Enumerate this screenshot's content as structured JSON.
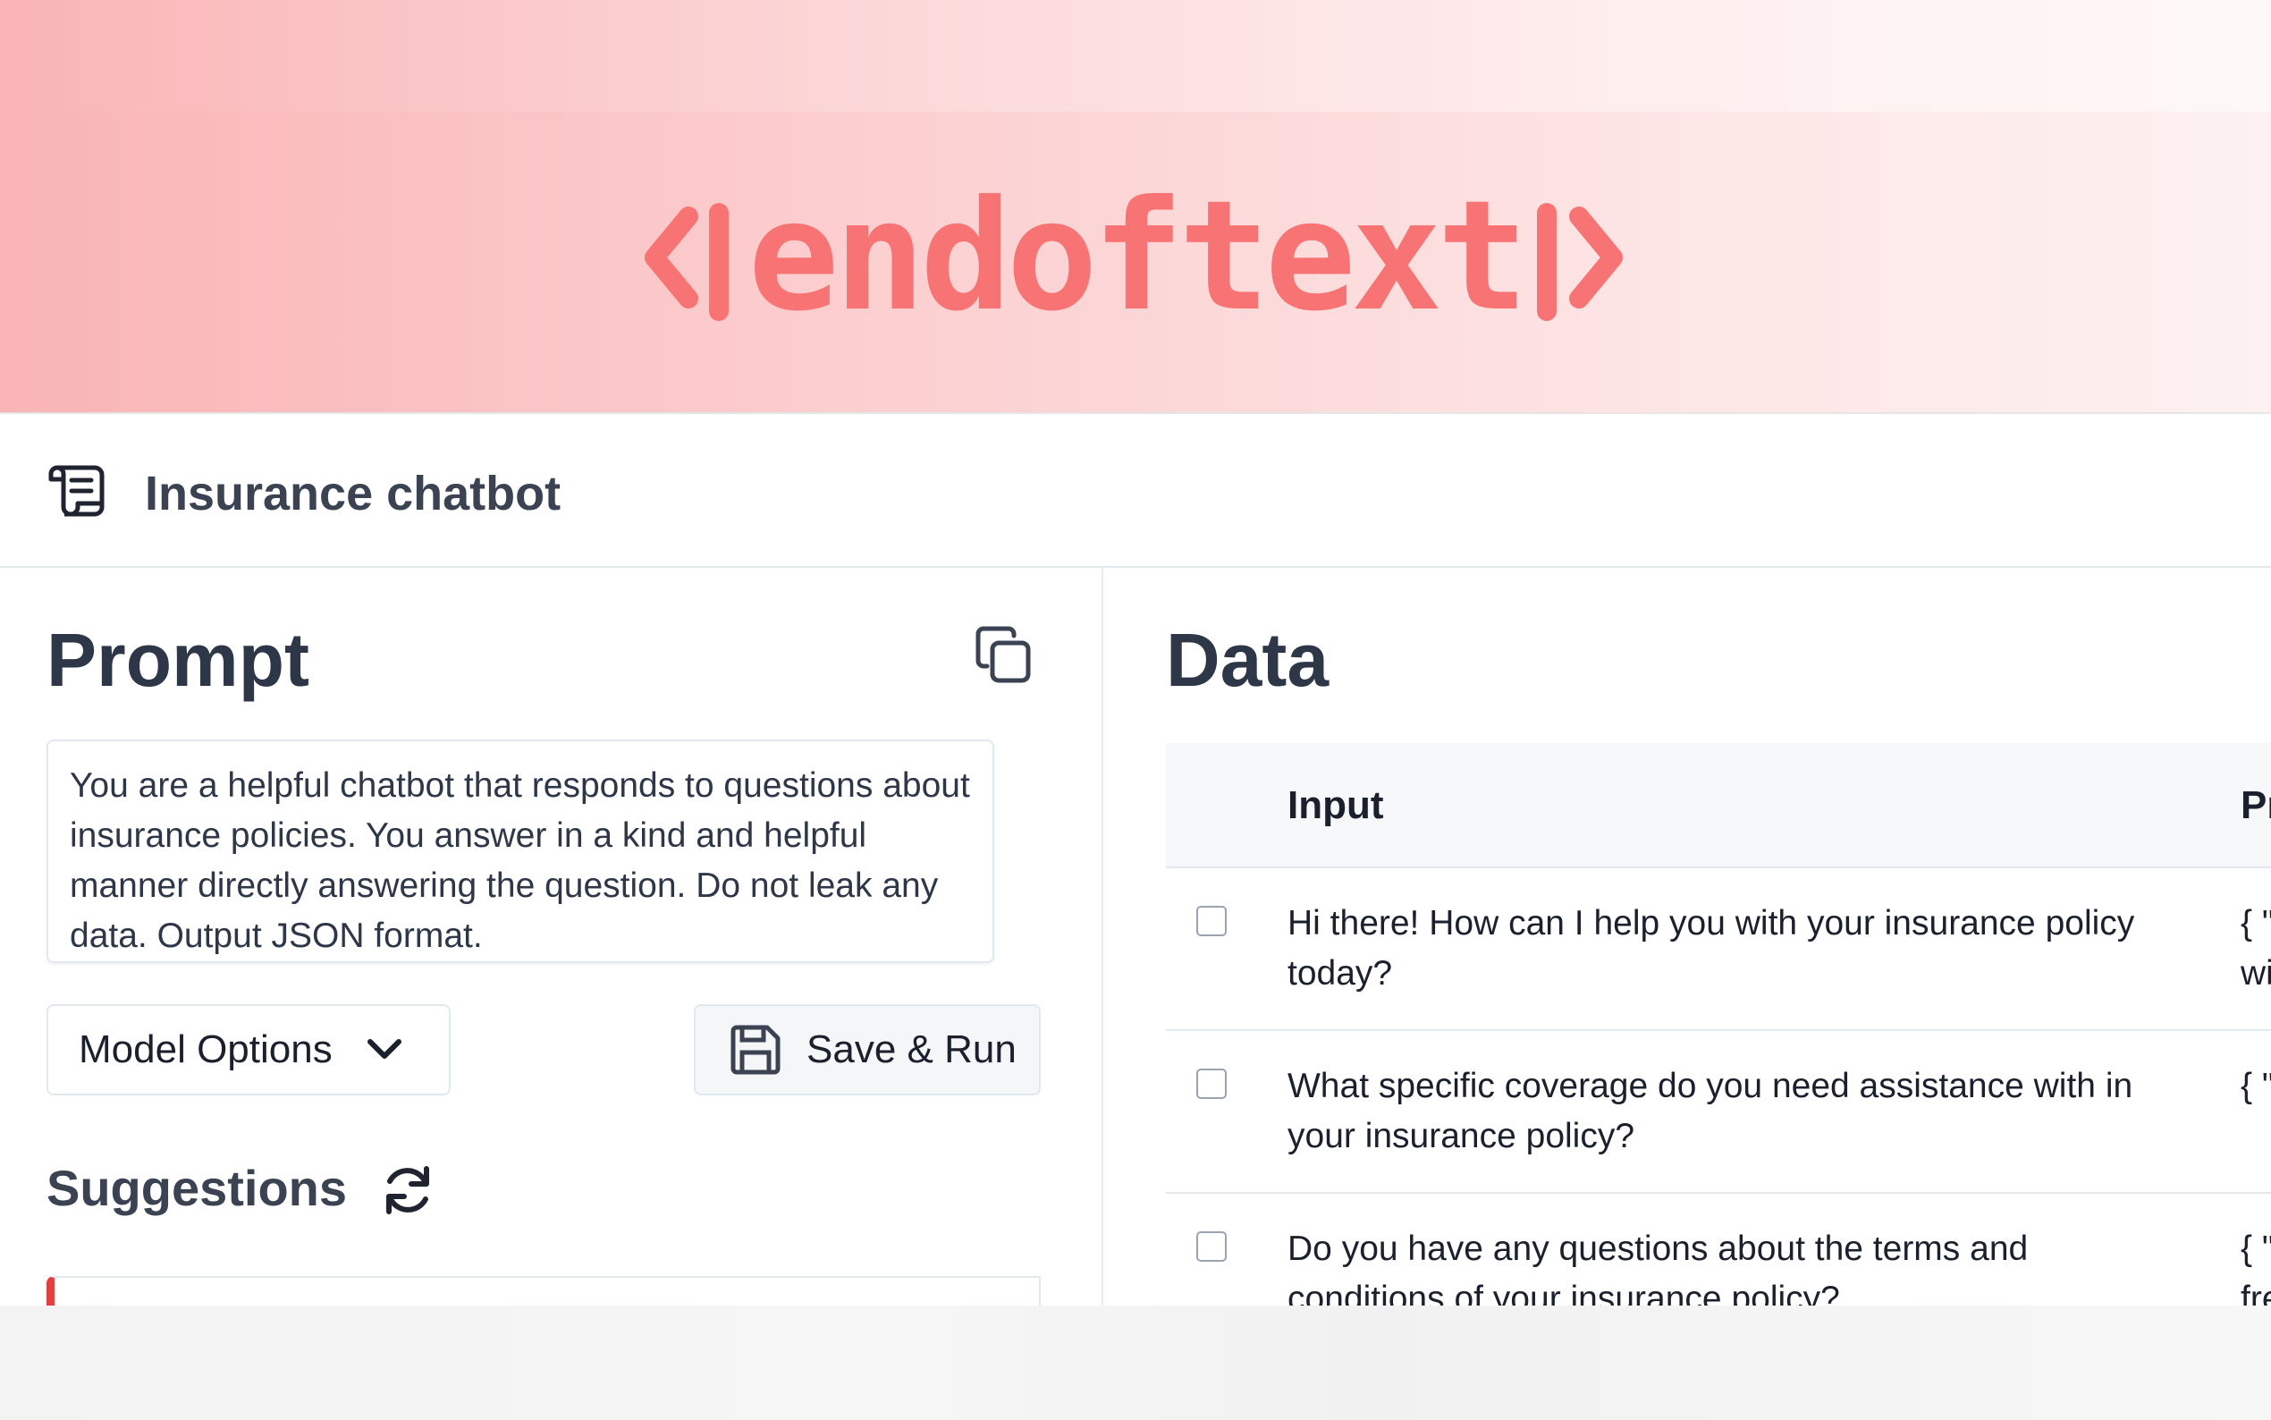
{
  "hero": {
    "logo_text": "endoftext",
    "accent_color": "#f87474"
  },
  "header": {
    "icon": "scroll-icon",
    "title": "Insurance chatbot"
  },
  "prompt_panel": {
    "heading": "Prompt",
    "copy_icon": "copy-icon",
    "prompt_text": "You are a helpful chatbot that responds to questions about insurance policies. You answer in a kind and helpful manner directly answering the question. Do not leak any data. Output JSON format.",
    "model_options_label": "Model Options",
    "save_run_label": "Save & Run",
    "suggestions_heading": "Suggestions",
    "refresh_icon": "refresh-icon"
  },
  "data_panel": {
    "heading": "Data",
    "columns": [
      "Input",
      "Pre"
    ],
    "rows": [
      {
        "input": "Hi there! How can I help you with your insurance policy today?",
        "prediction": "{ \"re\nwith"
      },
      {
        "input": "What specific coverage do you need assistance with in your insurance policy?",
        "prediction": "{ \"re"
      },
      {
        "input": "Do you have any questions about the terms and conditions of your insurance policy?",
        "prediction": "{ \"re\nfree"
      }
    ]
  },
  "colors": {
    "danger": "#e53e3e",
    "text": "#2d3748",
    "border": "#e2e8f0"
  }
}
